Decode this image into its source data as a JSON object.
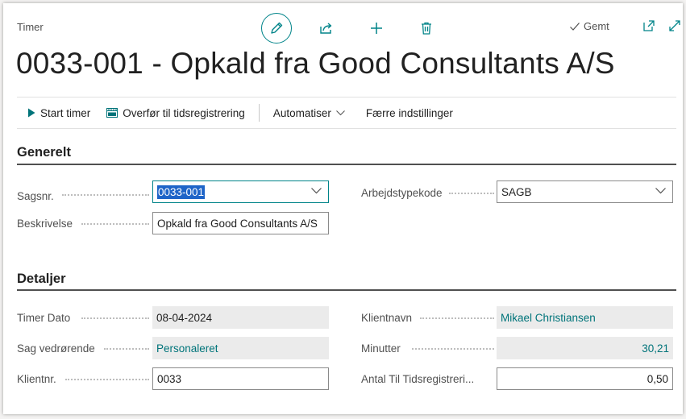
{
  "header": {
    "page_label": "Timer",
    "saved_label": "Gemt",
    "title": "0033-001 - Opkald fra Good Consultants A/S",
    "icons": [
      "pencil-icon",
      "share-icon",
      "plus-icon",
      "trash-icon",
      "check-icon",
      "open-new-window-icon",
      "expand-icon"
    ]
  },
  "actionbar": {
    "start_timer": "Start timer",
    "transfer": "Overfør til tidsregistrering",
    "automate": "Automatiser",
    "fewer_options": "Færre indstillinger"
  },
  "generelt": {
    "title": "Generelt",
    "sagsnr_label": "Sagsnr.",
    "sagsnr_value": "0033-001",
    "beskrivelse_label": "Beskrivelse",
    "beskrivelse_value": "Opkald fra Good Consultants A/S",
    "arbejdstype_label": "Arbejdstypekode",
    "arbejdstype_value": "SAGB"
  },
  "detaljer": {
    "title": "Detaljer",
    "timer_dato_label": "Timer Dato",
    "timer_dato_value": "08-04-2024",
    "sag_vedr_label": "Sag vedrørende",
    "sag_vedr_value": "Personaleret",
    "klientnr_label": "Klientnr.",
    "klientnr_value": "0033",
    "klientnavn_label": "Klientnavn",
    "klientnavn_value": "Mikael Christiansen",
    "minutter_label": "Minutter",
    "minutter_value": "30,21",
    "antal_label": "Antal Til Tidsregistreri...",
    "antal_value": "0,50"
  },
  "colors": {
    "accent": "#008489",
    "link": "#00747a",
    "selection": "#1e64c8"
  }
}
